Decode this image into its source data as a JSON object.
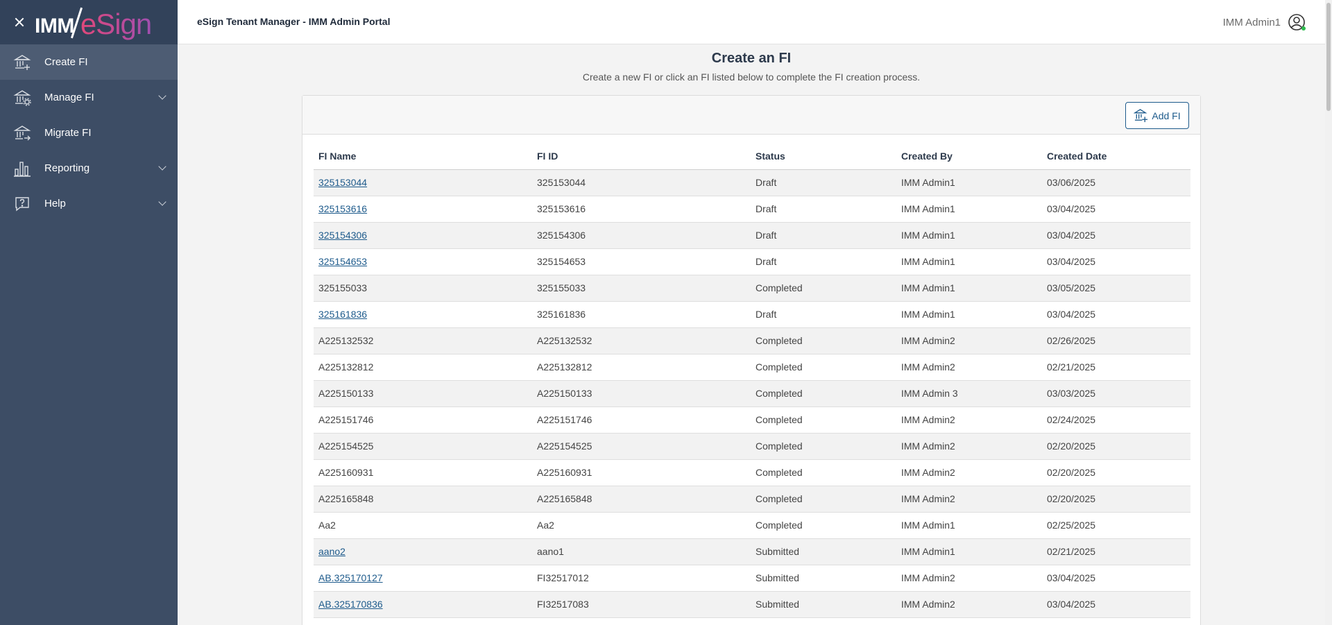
{
  "sidebar": {
    "logo": {
      "left": "IMM",
      "right": "eSign"
    },
    "items": [
      {
        "label": "Create FI",
        "icon": "bank-add-icon",
        "active": true,
        "expandable": false
      },
      {
        "label": "Manage FI",
        "icon": "bank-gear-icon",
        "active": false,
        "expandable": true
      },
      {
        "label": "Migrate FI",
        "icon": "bank-migrate-icon",
        "active": false,
        "expandable": false
      },
      {
        "label": "Reporting",
        "icon": "bar-chart-icon",
        "active": false,
        "expandable": true
      },
      {
        "label": "Help",
        "icon": "help-bubble-icon",
        "active": false,
        "expandable": true
      }
    ]
  },
  "header": {
    "title": "eSign Tenant Manager - IMM Admin Portal",
    "user_name": "IMM Admin1"
  },
  "main": {
    "title": "Create an FI",
    "subtitle": "Create a new FI or click an FI listed below to complete the FI creation process.",
    "add_button_label": "Add FI",
    "table": {
      "columns": [
        "FI Name",
        "FI ID",
        "Status",
        "Created By",
        "Created Date"
      ],
      "rows": [
        {
          "name": "325153044",
          "link": true,
          "id": "325153044",
          "status": "Draft",
          "created_by": "IMM Admin1",
          "date": "03/06/2025"
        },
        {
          "name": "325153616",
          "link": true,
          "id": "325153616",
          "status": "Draft",
          "created_by": "IMM Admin1",
          "date": "03/04/2025"
        },
        {
          "name": "325154306",
          "link": true,
          "id": "325154306",
          "status": "Draft",
          "created_by": "IMM Admin1",
          "date": "03/04/2025"
        },
        {
          "name": "325154653",
          "link": true,
          "id": "325154653",
          "status": "Draft",
          "created_by": "IMM Admin1",
          "date": "03/04/2025"
        },
        {
          "name": "325155033",
          "link": false,
          "id": "325155033",
          "status": "Completed",
          "created_by": "IMM Admin1",
          "date": "03/05/2025"
        },
        {
          "name": "325161836",
          "link": true,
          "id": "325161836",
          "status": "Draft",
          "created_by": "IMM Admin1",
          "date": "03/04/2025"
        },
        {
          "name": "A225132532",
          "link": false,
          "id": "A225132532",
          "status": "Completed",
          "created_by": "IMM Admin2",
          "date": "02/26/2025"
        },
        {
          "name": "A225132812",
          "link": false,
          "id": "A225132812",
          "status": "Completed",
          "created_by": "IMM Admin2",
          "date": "02/21/2025"
        },
        {
          "name": "A225150133",
          "link": false,
          "id": "A225150133",
          "status": "Completed",
          "created_by": "IMM Admin 3",
          "date": "03/03/2025"
        },
        {
          "name": "A225151746",
          "link": false,
          "id": "A225151746",
          "status": "Completed",
          "created_by": "IMM Admin2",
          "date": "02/24/2025"
        },
        {
          "name": "A225154525",
          "link": false,
          "id": "A225154525",
          "status": "Completed",
          "created_by": "IMM Admin2",
          "date": "02/20/2025"
        },
        {
          "name": "A225160931",
          "link": false,
          "id": "A225160931",
          "status": "Completed",
          "created_by": "IMM Admin2",
          "date": "02/20/2025"
        },
        {
          "name": "A225165848",
          "link": false,
          "id": "A225165848",
          "status": "Completed",
          "created_by": "IMM Admin2",
          "date": "02/20/2025"
        },
        {
          "name": "Aa2",
          "link": false,
          "id": "Aa2",
          "status": "Completed",
          "created_by": "IMM Admin1",
          "date": "02/25/2025"
        },
        {
          "name": "aano2",
          "link": true,
          "id": "aano1",
          "status": "Submitted",
          "created_by": "IMM Admin1",
          "date": "02/21/2025"
        },
        {
          "name": "AB.325170127",
          "link": true,
          "id": "FI32517012",
          "status": "Submitted",
          "created_by": "IMM Admin2",
          "date": "03/04/2025"
        },
        {
          "name": "AB.325170836",
          "link": true,
          "id": "FI32517083",
          "status": "Submitted",
          "created_by": "IMM Admin2",
          "date": "03/04/2025"
        }
      ]
    }
  },
  "colors": {
    "sidebar_bg": "#3d4d65",
    "sidebar_active": "#4d5c73",
    "link": "#1e5b8c",
    "online": "#2dbb4e"
  }
}
